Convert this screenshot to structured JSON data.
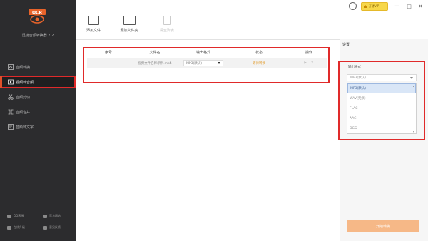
{
  "app": {
    "name": "迅捷音频转换器 7.2"
  },
  "sidebar": {
    "items": [
      {
        "label": "音频转换",
        "icon": "audio-convert-icon",
        "active": false
      },
      {
        "label": "视频转音频",
        "icon": "video-to-audio-icon",
        "active": true
      },
      {
        "label": "音频剪切",
        "icon": "scissors-icon",
        "active": false
      },
      {
        "label": "音频合并",
        "icon": "merge-icon",
        "active": false
      },
      {
        "label": "音频转文字",
        "icon": "audio-to-text-icon",
        "active": false
      }
    ],
    "footer": [
      "QQ客服",
      "官方网站",
      "在线升级",
      "意见反馈"
    ]
  },
  "topbar": {
    "vip_label": "开通VIP",
    "window_buttons": [
      "－",
      "□",
      "×"
    ]
  },
  "toolbar": {
    "add_file": "添加文件",
    "add_folder": "添加文件夹",
    "clear_list": "清空列表"
  },
  "table": {
    "columns": [
      "序号",
      "文件名",
      "输出格式",
      "状态",
      "操作"
    ],
    "rows": [
      {
        "index": "",
        "filename": "视频文件名称示例.mp4",
        "format": "MP3(默认)",
        "status": "等待转换",
        "ops": [
          "▶",
          "✕"
        ]
      }
    ]
  },
  "settings": {
    "title": "设置",
    "field_label": "输出格式",
    "selected": "MP3(默认)",
    "options": [
      "MP3(默认)",
      "WAV(无损)",
      "FLAC",
      "AAC",
      "OGG"
    ]
  },
  "convert_button": "开始转换"
}
